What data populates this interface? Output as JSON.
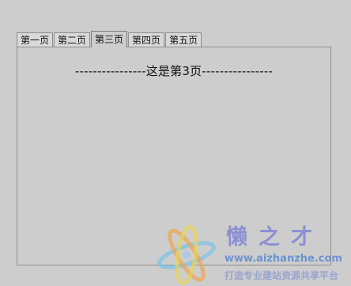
{
  "tabs": [
    {
      "label": "第一页",
      "active": false
    },
    {
      "label": "第二页",
      "active": false
    },
    {
      "label": "第三页",
      "active": true
    },
    {
      "label": "第四页",
      "active": false
    },
    {
      "label": "第五页",
      "active": false
    }
  ],
  "panel": {
    "content_text": "----------------这是第3页----------------"
  },
  "watermark": {
    "brand": "懒之才",
    "url": "www.aizhanzhe.com",
    "tagline": "打造专业建站资源共享平台"
  },
  "colors": {
    "background": "#cdcdcd",
    "border": "#8e8e8e",
    "watermark_text": "#8c8fd2"
  }
}
